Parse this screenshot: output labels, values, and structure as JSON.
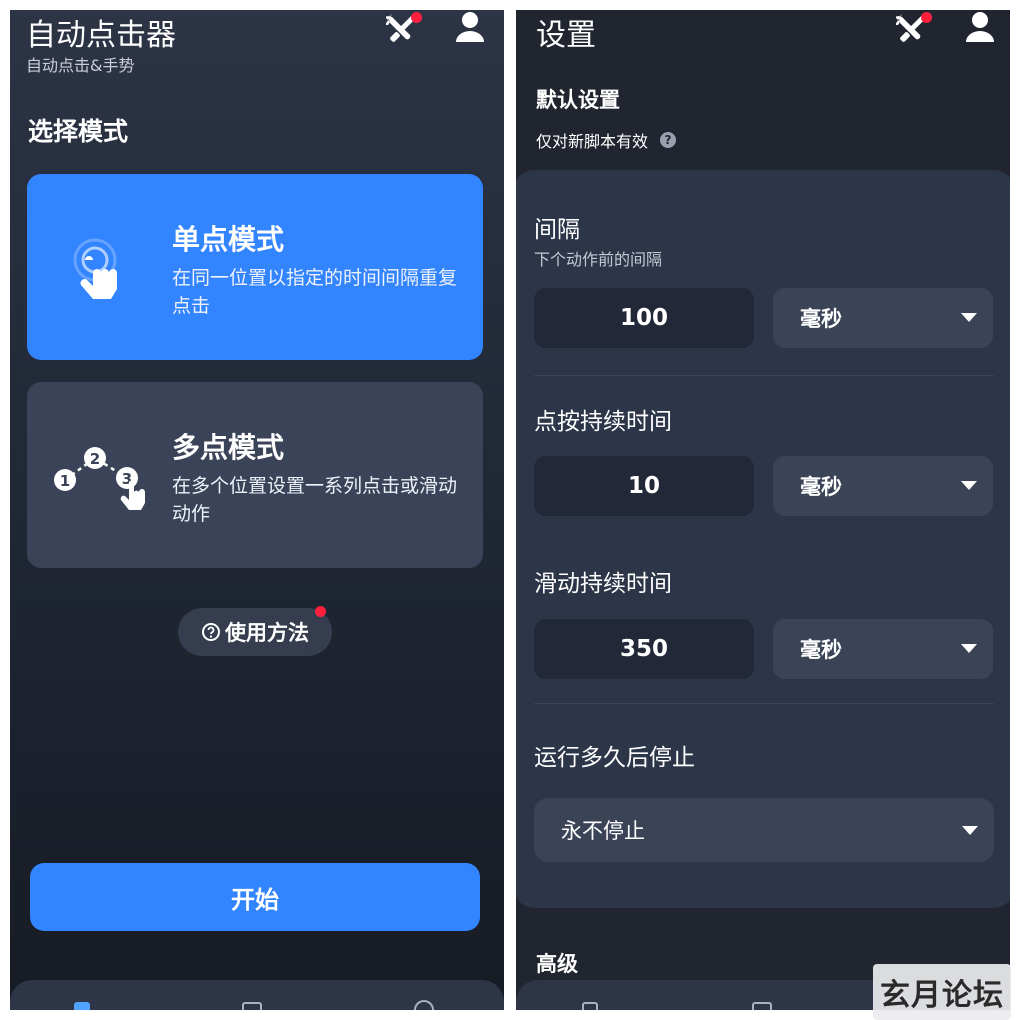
{
  "left": {
    "app_title": "自动点击器",
    "app_subtitle": "自动点击&手势",
    "icons": {
      "tools": "wrench-screwdriver-icon",
      "account": "person-icon"
    },
    "section_title": "选择模式",
    "modes": [
      {
        "title": "单点模式",
        "desc": "在同一位置以指定的时间间隔重复点击",
        "icon": "tap-hand-icon",
        "color": "#3384ff"
      },
      {
        "title": "多点模式",
        "desc": "在多个位置设置一系列点击或滑动动作",
        "icon": "multi-point-icon",
        "color": "#3a4357"
      }
    ],
    "multi_steps": [
      "1",
      "2",
      "3"
    ],
    "howto_label": "使用方法",
    "start_label": "开始"
  },
  "right": {
    "page_title": "设置",
    "section_title": "默认设置",
    "section_hint": "仅对新脚本有效",
    "fields": [
      {
        "label": "间隔",
        "hint": "下个动作前的间隔",
        "value": "100",
        "unit": "毫秒"
      },
      {
        "label": "点按持续时间",
        "value": "10",
        "unit": "毫秒"
      },
      {
        "label": "滑动持续时间",
        "value": "350",
        "unit": "毫秒"
      }
    ],
    "stop_label": "运行多久后停止",
    "stop_value": "永不停止",
    "advanced_title": "高级"
  },
  "watermark": "玄月论坛",
  "colors": {
    "accent": "#3384ff",
    "notification": "#ff1f3d"
  }
}
